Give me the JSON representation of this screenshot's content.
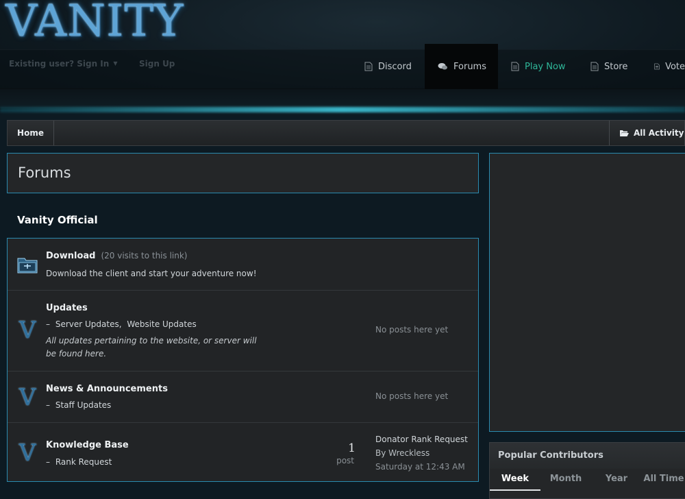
{
  "site": {
    "logo_text": "VANITY"
  },
  "userbar": {
    "sign_in": "Existing user? Sign In",
    "sign_up": "Sign Up"
  },
  "nav": {
    "discord": "Discord",
    "forums": "Forums",
    "play_now": "Play Now",
    "store": "Store",
    "vote": "Vote"
  },
  "breadcrumb": {
    "home": "Home",
    "all_activity": "All Activity"
  },
  "page": {
    "title": "Forums"
  },
  "category": {
    "title": "Vanity Official"
  },
  "forums": {
    "download": {
      "name": "Download",
      "visits": "(20 visits to this link)",
      "desc": "Download the client and start your adventure now!"
    },
    "updates": {
      "name": "Updates",
      "subs": [
        "Server Updates,",
        "Website Updates"
      ],
      "desc": "All updates pertaining to the website, or server will be found here.",
      "status": "No posts here yet"
    },
    "news": {
      "name": "News & Announcements",
      "subs": [
        "Staff Updates"
      ],
      "status": "No posts here yet"
    },
    "kb": {
      "name": "Knowledge Base",
      "subs": [
        "Rank Request"
      ],
      "post_count": "1",
      "post_label": "post",
      "last_title": "Donator Rank Request",
      "last_by": "By Wreckless",
      "last_time": "Saturday at 12:43 AM"
    }
  },
  "sidebar": {
    "contributors": {
      "title": "Popular Contributors",
      "tabs": [
        "Week",
        "Month",
        "Year",
        "All Time"
      ]
    }
  },
  "colors": {
    "accent": "#2a8bb0",
    "play_now": "#2fb89a"
  },
  "icons": {
    "nav_page": "document-icon",
    "nav_forums": "chat-bubbles-icon",
    "all_activity": "folder-open-icon",
    "forum_download": "download-folder-icon",
    "forum_default": "vanity-v-icon"
  }
}
